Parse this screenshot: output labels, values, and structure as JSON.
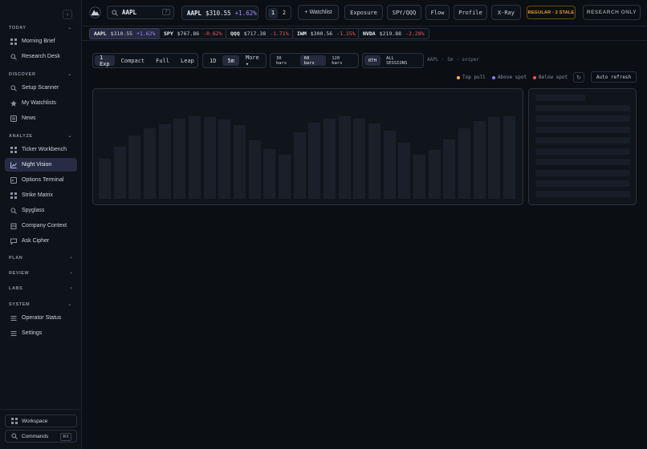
{
  "sidebar": {
    "sections": [
      {
        "label": "TODAY",
        "chevron": "⌄"
      },
      {
        "label": "DISCOVER",
        "chevron": "⌄"
      },
      {
        "label": "ANALYZE",
        "chevron": "⌄"
      },
      {
        "label": "PLAN",
        "chevron": "›"
      },
      {
        "label": "REVIEW",
        "chevron": "›"
      },
      {
        "label": "LABS",
        "chevron": "›"
      },
      {
        "label": "SYSTEM",
        "chevron": "⌄"
      }
    ],
    "items": [
      {
        "label": "Morning Brief",
        "icon": "grid-icon"
      },
      {
        "label": "Research Desk",
        "icon": "search-icon"
      },
      {
        "label": "Setup Scanner",
        "icon": "search-icon"
      },
      {
        "label": "My Watchlists",
        "icon": "star-icon"
      },
      {
        "label": "News",
        "icon": "news-icon"
      },
      {
        "label": "Ticker Workbench",
        "icon": "grid-icon"
      },
      {
        "label": "Night Vision",
        "icon": "chart-icon"
      },
      {
        "label": "Options Terminal",
        "icon": "terminal-icon"
      },
      {
        "label": "Strike Matrix",
        "icon": "grid-icon"
      },
      {
        "label": "Spyglass",
        "icon": "search-icon"
      },
      {
        "label": "Company Context",
        "icon": "building-icon"
      },
      {
        "label": "Ask Cipher",
        "icon": "chat-icon"
      },
      {
        "label": "Operator Status",
        "icon": "list-icon"
      },
      {
        "label": "Settings",
        "icon": "list-icon"
      }
    ],
    "footer": {
      "workspace_label": "Workspace",
      "commands_label": "Commands",
      "commands_kbd": "⌘K"
    }
  },
  "topbar": {
    "search_value": "AAPL",
    "search_shortcut": "/",
    "quote": {
      "ticker": "AAPL",
      "price": "$310.55",
      "change": "+1.62%"
    },
    "layout_options": [
      "1",
      "2"
    ],
    "watchlist_label": "+ Watchlist",
    "exposure_label": "Exposure",
    "spyqqq_label": "SPY/QQQ",
    "flow_label": "Flow",
    "profile_label": "Profile",
    "xray_label": "X-Ray",
    "stale_label": "REGULAR · 2 STALE",
    "research_label": "RESEARCH ONLY"
  },
  "tape": [
    {
      "ticker": "AAPL",
      "price": "$310.55",
      "change": "+1.62%",
      "dir": "up"
    },
    {
      "ticker": "SPY",
      "price": "$767.86",
      "change": "-0.62%",
      "dir": "down"
    },
    {
      "ticker": "QQQ",
      "price": "$717.38",
      "change": "-1.71%",
      "dir": "down"
    },
    {
      "ticker": "IWM",
      "price": "$300.56",
      "change": "-1.15%",
      "dir": "down"
    },
    {
      "ticker": "NVDA",
      "price": "$219.88",
      "change": "-2.28%",
      "dir": "down"
    }
  ],
  "controls": {
    "expiry": [
      "1 Exp",
      "Compact",
      "Full",
      "Leap"
    ],
    "timeframe": [
      "1D",
      "5m",
      "More ▾"
    ],
    "bars": [
      "30 bars",
      "60 bars",
      "120 bars"
    ],
    "session": [
      "RTH",
      "ALL SESSIONS"
    ],
    "context": "AAPL · 5m · sniper"
  },
  "legend": {
    "top_pull": "Top pull",
    "above_spot": "Above spot",
    "below_spot": "Below spot",
    "colors": {
      "top_pull": "#f5b83d",
      "above_spot": "#8b7cf6",
      "below_spot": "#f2545b"
    },
    "refresh_icon": "↻",
    "auto_refresh_label": "Auto refresh"
  }
}
